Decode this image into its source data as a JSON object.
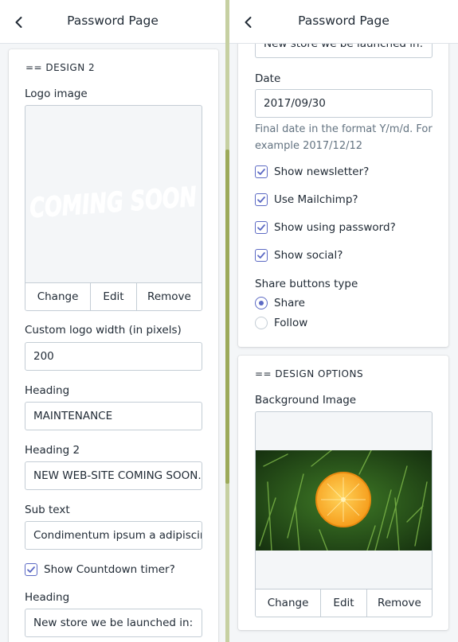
{
  "left_panel": {
    "header": {
      "title": "Password Page",
      "back_icon": "chevron-left-icon"
    },
    "section_heading": "== DESIGN 2",
    "logo_image": {
      "label": "Logo image",
      "preview_text": "COMING SOON",
      "actions": {
        "change": "Change",
        "edit": "Edit",
        "remove": "Remove"
      }
    },
    "custom_logo_width": {
      "label": "Custom logo width (in pixels)",
      "value": "200"
    },
    "heading": {
      "label": "Heading",
      "value": "MAINTENANCE"
    },
    "heading_2": {
      "label": "Heading 2",
      "value": "NEW WEB-SITE COMING SOON.."
    },
    "sub_text": {
      "label": "Sub text",
      "value": "Condimentum ipsum a adipiscing"
    },
    "show_countdown": {
      "label": "Show Countdown timer?",
      "checked": true
    },
    "countdown_heading": {
      "label": "Heading",
      "value": "New store we be launched in:"
    }
  },
  "right_panel": {
    "header": {
      "title": "Password Page",
      "back_icon": "chevron-left-icon"
    },
    "partial_field": {
      "value": "New store we be launched in:"
    },
    "date": {
      "label": "Date",
      "value": "2017/09/30",
      "help": "Final date in the format Y/m/d. For example 2017/12/12"
    },
    "checkboxes": [
      {
        "label": "Show newsletter?",
        "checked": true
      },
      {
        "label": "Use Mailchimp?",
        "checked": true
      },
      {
        "label": "Show using password?",
        "checked": true
      },
      {
        "label": "Show social?",
        "checked": true
      }
    ],
    "share_buttons": {
      "label": "Share buttons type",
      "options": [
        {
          "label": "Share",
          "selected": true
        },
        {
          "label": "Follow",
          "selected": false
        }
      ]
    },
    "design_options": {
      "section_heading": "== DESIGN OPTIONS",
      "background_image": {
        "label": "Background Image",
        "actions": {
          "change": "Change",
          "edit": "Edit",
          "remove": "Remove"
        }
      }
    }
  },
  "colors": {
    "accent": "#5c6ac4",
    "border": "#c4cdd5",
    "background": "#f4f6f8",
    "gutter": "#c6d0a2"
  }
}
